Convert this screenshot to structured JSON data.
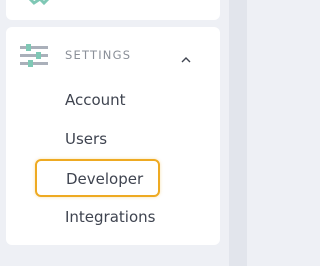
{
  "sidebar": {
    "section": {
      "title": "SETTINGS",
      "icon": "sliders-icon",
      "expanded": true,
      "chevron_icon": "chevron-up-icon"
    },
    "items": [
      {
        "label": "Account"
      },
      {
        "label": "Users"
      },
      {
        "label": "Developer",
        "highlighted": true
      },
      {
        "label": "Integrations"
      }
    ]
  },
  "colors": {
    "background": "#eef0f5",
    "card": "#ffffff",
    "text": "#3f4450",
    "muted": "#8a8f98",
    "highlight": "#eeaa22",
    "icon_teal": "#7fc8b5"
  }
}
